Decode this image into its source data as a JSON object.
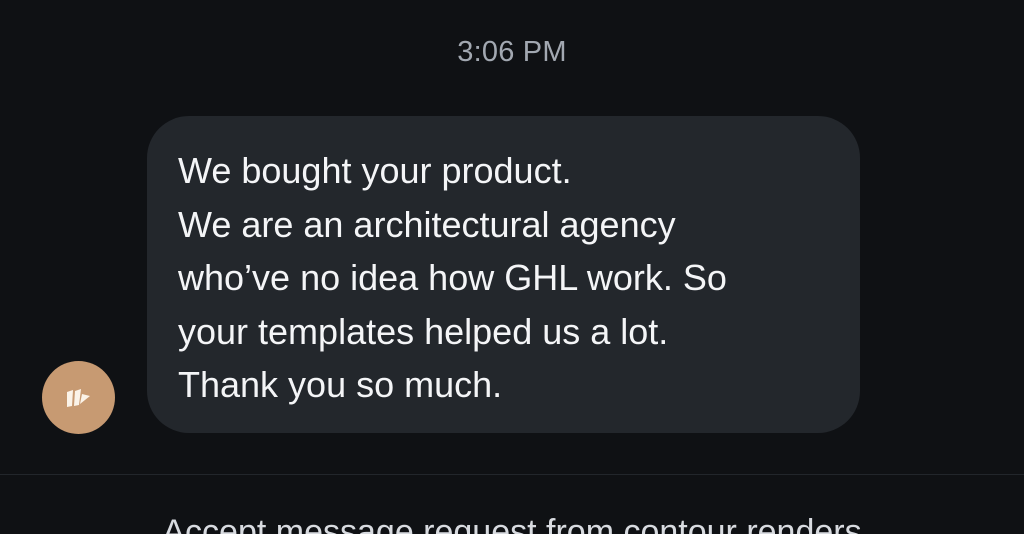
{
  "conversation": {
    "timestamp": "3:06 PM",
    "message": {
      "lines": [
        "We bought your product.",
        "We are an architectural agency",
        "who’ve no idea how GHL work. So",
        "your templates helped us a lot.",
        "Thank you so much."
      ]
    },
    "sender_avatar": {
      "icon": "brand-logo-icon",
      "background": "#c79a72"
    }
  },
  "footer": {
    "request_text": "Accept message request from contour renders"
  },
  "colors": {
    "background": "#0f1114",
    "bubble": "#23272c",
    "timestamp": "#a2a8b1",
    "text": "#f4f5f7"
  }
}
